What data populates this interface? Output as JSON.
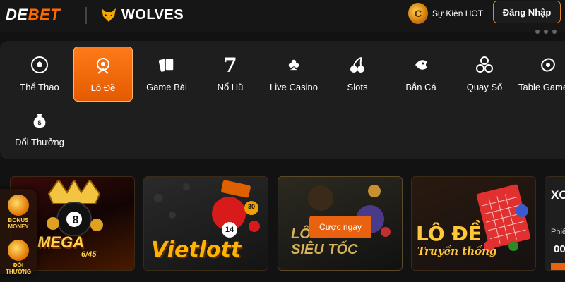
{
  "header": {
    "brand_part1": "DE",
    "brand_part2": "BET",
    "partner": "WOLVES",
    "hot_event_label": "Sự Kiện HOT",
    "login_label": "Đăng Nhập"
  },
  "categories": [
    {
      "label": "Thể Thao",
      "icon": "soccer-ball-icon",
      "active": false
    },
    {
      "label": "Lô Đề",
      "icon": "lottery-wheel-icon",
      "active": true
    },
    {
      "label": "Game Bài",
      "icon": "cards-icon",
      "active": false
    },
    {
      "label": "Nổ Hũ",
      "icon": "seven-icon",
      "active": false
    },
    {
      "label": "Live Casino",
      "icon": "club-suit-icon",
      "active": false
    },
    {
      "label": "Slots",
      "icon": "cherry-icon",
      "active": false
    },
    {
      "label": "Bắn Cá",
      "icon": "fish-icon",
      "active": false
    },
    {
      "label": "Quay Số",
      "icon": "balls-icon",
      "active": false
    },
    {
      "label": "Table Game",
      "icon": "table-game-icon",
      "active": false
    },
    {
      "label": "Đổi Thưởng",
      "icon": "money-bag-icon",
      "active": false
    }
  ],
  "games": {
    "mega": {
      "title": "MEGA",
      "subtitle": "6/45",
      "ball_number": "8"
    },
    "vietlott": {
      "title": "Vietlott",
      "ball_1": "14",
      "ball_2": "30"
    },
    "lo_sieu_toc": {
      "title": "LÔ ĐỀ",
      "subtitle": "SIÊU TỐC",
      "cta": "Cược ngay"
    },
    "lo_de_truyen_thong": {
      "title": "LÔ ĐỀ",
      "subtitle": "Truyền thống"
    },
    "partial": {
      "title": "XO",
      "label": "Phiê",
      "number": "00"
    }
  },
  "side_promos": [
    {
      "label": "BONUS MONEY"
    },
    {
      "label": "ĐỔI THƯỞNG"
    }
  ],
  "colors": {
    "accent": "#e8620f",
    "active_category": "#ff7a1a",
    "gold": "#ffd34a"
  }
}
